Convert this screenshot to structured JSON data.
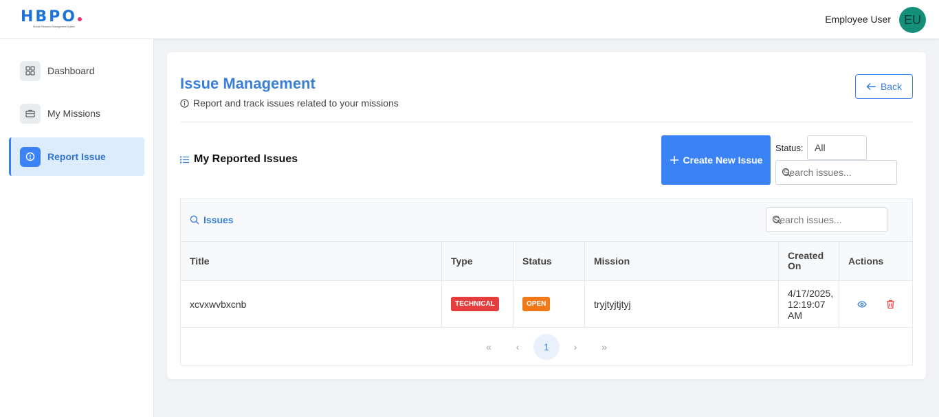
{
  "header": {
    "logo_text": "HBPO",
    "logo_subtitle": "Human Resource Management System",
    "user_name": "Employee User",
    "avatar_initials": "EU",
    "colors": {
      "brand": "#1e73d8",
      "avatar": "#14907a",
      "accent": "#3b82f6"
    }
  },
  "sidebar": {
    "items": [
      {
        "label": "Dashboard",
        "icon": "grid-icon",
        "active": false
      },
      {
        "label": "My Missions",
        "icon": "briefcase-icon",
        "active": false
      },
      {
        "label": "Report Issue",
        "icon": "alert-circle-icon",
        "active": true
      }
    ]
  },
  "main": {
    "title": "Issue Management",
    "subtitle": "Report and track issues related to your missions",
    "back_label": "Back",
    "section_title": "My Reported Issues",
    "create_label": "Create New Issue",
    "status_label": "Status:",
    "status_value": "All",
    "search_placeholder": "Search issues...",
    "table": {
      "heading": "Issues",
      "search_placeholder": "Search issues...",
      "columns": [
        "Title",
        "Type",
        "Status",
        "Mission",
        "Created On",
        "Actions"
      ],
      "rows": [
        {
          "title": "xcvxwvbxcnb",
          "type": "TECHNICAL",
          "status": "OPEN",
          "mission": "tryjtyjtjtyj",
          "created_on": "4/17/2025, 12:19:07 AM"
        }
      ],
      "actions": [
        "eye-icon",
        "trash-icon"
      ]
    },
    "pagination": {
      "current_page": "1",
      "first": "«",
      "prev": "‹",
      "next": "›",
      "last": "»"
    }
  }
}
